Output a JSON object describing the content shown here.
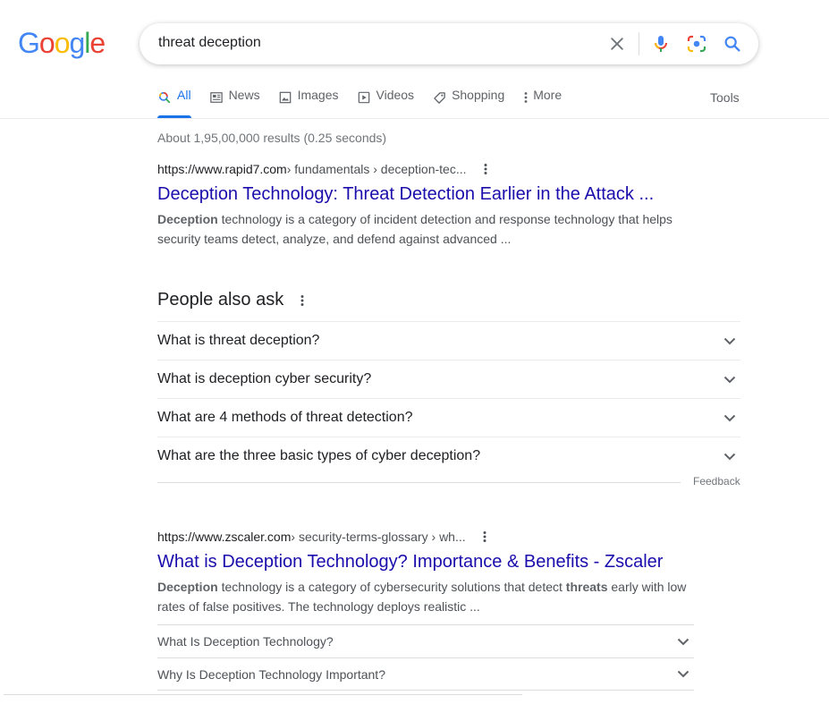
{
  "logo": {
    "letters": [
      {
        "ch": "G",
        "color": "#4285F4"
      },
      {
        "ch": "o",
        "color": "#EA4335"
      },
      {
        "ch": "o",
        "color": "#FBBC05"
      },
      {
        "ch": "g",
        "color": "#4285F4"
      },
      {
        "ch": "l",
        "color": "#34A853"
      },
      {
        "ch": "e",
        "color": "#EA4335"
      }
    ]
  },
  "search": {
    "query": "threat deception",
    "icons": [
      "clear-icon",
      "microphone-icon",
      "lens-camera-icon",
      "search-icon"
    ]
  },
  "tabs": [
    {
      "label": "All",
      "icon": "search-icon",
      "active": true
    },
    {
      "label": "News",
      "icon": "news-icon",
      "active": false
    },
    {
      "label": "Images",
      "icon": "image-icon",
      "active": false
    },
    {
      "label": "Videos",
      "icon": "video-icon",
      "active": false
    },
    {
      "label": "Shopping",
      "icon": "tag-icon",
      "active": false
    },
    {
      "label": "More",
      "icon": "more-vert-icon",
      "active": false
    }
  ],
  "tools_label": "Tools",
  "stats": "About 1,95,00,000 results (0.25 seconds)",
  "results": [
    {
      "url_host": "https://www.rapid7.com",
      "url_path": " › fundamentals › deception-tec...",
      "title": "Deception Technology: Threat Detection Earlier in the Attack ...",
      "snippet_bold": "Deception",
      "snippet_rest": " technology is a category of incident detection and response technology that helps security teams detect, analyze, and defend against advanced ..."
    },
    {
      "url_host": "https://www.zscaler.com",
      "url_path": " › security-terms-glossary › wh...",
      "title": "What is Deception Technology? Importance & Benefits - Zscaler",
      "snippet_bold": "Deception",
      "snippet_mid": " technology is a category of cybersecurity solutions that detect ",
      "snippet_bold2": "threats",
      "snippet_rest": " early with low rates of false positives. The technology deploys realistic ...",
      "sublinks": [
        "What Is Deception Technology?",
        "Why Is Deception Technology Important?"
      ]
    }
  ],
  "people_also_ask": {
    "title": "People also ask",
    "questions": [
      "What is threat deception?",
      "What is deception cyber security?",
      "What are 4 methods of threat detection?",
      "What are the three basic types of cyber deception?"
    ],
    "feedback": "Feedback"
  },
  "colors": {
    "link": "#1a0dab",
    "accent": "#1a73e8",
    "text": "#202124",
    "muted": "#70757a"
  }
}
